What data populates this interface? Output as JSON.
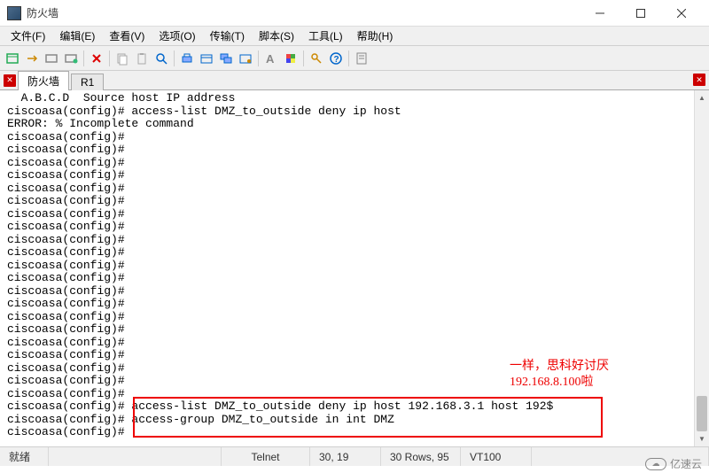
{
  "window": {
    "title": "防火墙"
  },
  "menu": {
    "file": "文件(F)",
    "edit": "编辑(E)",
    "view": "查看(V)",
    "options": "选项(O)",
    "transfer": "传输(T)",
    "script": "脚本(S)",
    "tools": "工具(L)",
    "help": "帮助(H)"
  },
  "tabs": {
    "tab1": "防火墙",
    "tab2": "R1"
  },
  "terminal": {
    "content": "  A.B.C.D  Source host IP address\nciscoasa(config)# access-list DMZ_to_outside deny ip host\nERROR: % Incomplete command\nciscoasa(config)#\nciscoasa(config)#\nciscoasa(config)#\nciscoasa(config)#\nciscoasa(config)#\nciscoasa(config)#\nciscoasa(config)#\nciscoasa(config)#\nciscoasa(config)#\nciscoasa(config)#\nciscoasa(config)#\nciscoasa(config)#\nciscoasa(config)#\nciscoasa(config)#\nciscoasa(config)#\nciscoasa(config)#\nciscoasa(config)#\nciscoasa(config)#\nciscoasa(config)#\nciscoasa(config)#\nciscoasa(config)#\nciscoasa(config)# access-list DMZ_to_outside deny ip host 192.168.3.1 host 192$\nciscoasa(config)# access-group DMZ_to_outside in int DMZ\nciscoasa(config)#"
  },
  "annotations": {
    "line1": "一样，思科好讨厌",
    "line2": "192.168.8.100啦"
  },
  "status": {
    "ready": "就绪",
    "protocol": "Telnet",
    "cursor": "30, 19",
    "rows": "30 Rows, 95",
    "term": "VT100"
  },
  "watermark": {
    "text": "亿速云"
  }
}
